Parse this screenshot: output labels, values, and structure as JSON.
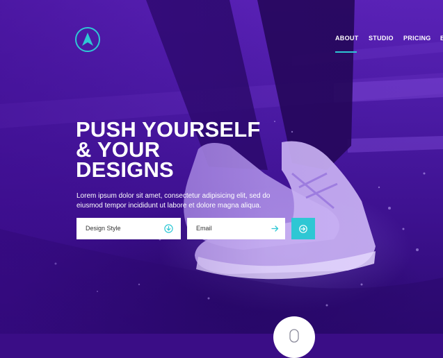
{
  "colors": {
    "accent": "#2ec7d4",
    "background": "#4a1aa3",
    "text": "#ffffff"
  },
  "logo": {
    "icon": "arrow-up-logo-icon"
  },
  "nav": {
    "items": [
      {
        "label": "ABOUT",
        "active": true
      },
      {
        "label": "STUDIO",
        "active": false
      },
      {
        "label": "PRICING",
        "active": false
      },
      {
        "label": "B",
        "active": false
      }
    ]
  },
  "hero": {
    "headline": [
      "PUSH YOURSELF",
      "& YOUR",
      "DESIGNS"
    ],
    "subtext": "Lorem ipsum dolor sit amet, consectetur adipisicing elit, sed do eiusmod tempor incididunt ut labore et dolore magna aliqua."
  },
  "form": {
    "design_style": {
      "label": "Design Style",
      "icon": "chevron-down-circle-icon"
    },
    "email": {
      "placeholder": "Email",
      "icon": "arrow-right-icon"
    },
    "submit": {
      "icon": "arrow-right-circle-icon"
    }
  },
  "scroll": {
    "icon": "mouse-icon"
  }
}
